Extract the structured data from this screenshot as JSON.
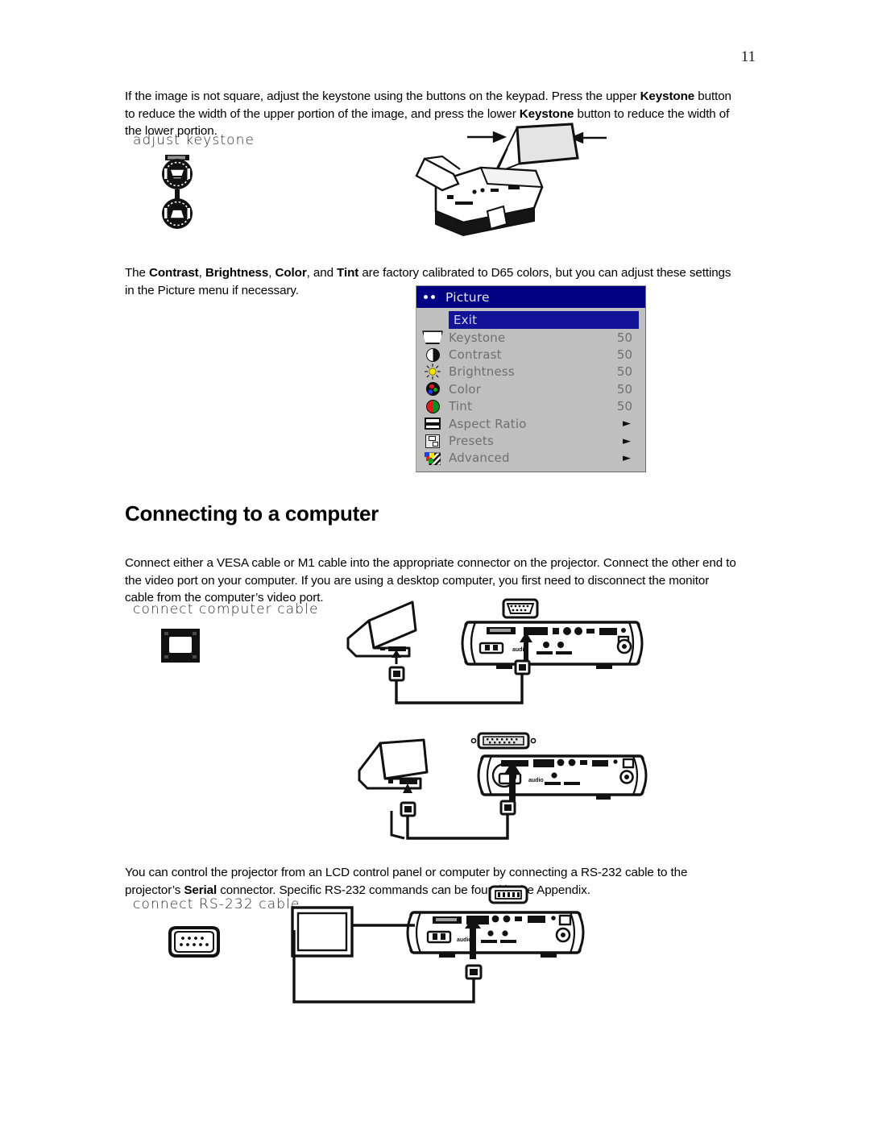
{
  "page": {
    "number": "11"
  },
  "paragraphs": {
    "keystone": {
      "seg1": "If the image is not square, adjust the keystone using the buttons on the keypad. Press the upper ",
      "bold1": "Keystone",
      "seg2": " button to reduce the width of the upper portion of the image, and press the lower ",
      "bold2": "Keystone",
      "seg3": " button to reduce the width of the lower portion."
    },
    "picture": {
      "seg1": "The ",
      "bold1": "Contrast",
      "seg2": ", ",
      "bold2": "Brightness",
      "seg3": ", ",
      "bold3": "Color",
      "seg4": ", and ",
      "bold4": "Tint",
      "seg5": " are factory calibrated to D65 colors, but you can adjust these settings in the Picture menu if necessary."
    },
    "connect": {
      "text": "Connect either a VESA cable or M1 cable into the appropriate connector on the projector. Connect the other end to the video port on your computer. If you are using a desktop computer, you first need to disconnect the monitor cable from the computer’s video port."
    },
    "rs232": {
      "seg1": "You can control the projector from an LCD control panel or computer by connecting a RS-232 cable to the projector’s ",
      "bold1": "Serial",
      "seg2": " connector. Specific RS-232 commands can be found in the Appendix."
    }
  },
  "heading": {
    "connecting_to_a_computer": "Connecting to a computer"
  },
  "captions": {
    "adjust_keystone": "adjust keystone",
    "connect_computer_cable": "connect computer cable",
    "connect_rs232_cable": "connect RS-232 cable"
  },
  "osd_menu": {
    "title": "Picture",
    "colors": {
      "title_bar": "#010183",
      "highlight": "#131397",
      "background": "#bfbfbf",
      "label_text": "#6f6f6f"
    },
    "rows": [
      {
        "label": "Exit",
        "value": "",
        "icon": "none",
        "selected": true
      },
      {
        "label": "Keystone",
        "value": "50",
        "icon": "keystone-icon",
        "selected": false
      },
      {
        "label": "Contrast",
        "value": "50",
        "icon": "contrast-icon",
        "selected": false
      },
      {
        "label": "Brightness",
        "value": "50",
        "icon": "brightness-icon",
        "selected": false
      },
      {
        "label": "Color",
        "value": "50",
        "icon": "color-icon",
        "selected": false
      },
      {
        "label": "Tint",
        "value": "50",
        "icon": "tint-icon",
        "selected": false
      },
      {
        "label": "Aspect Ratio",
        "value": "►",
        "icon": "aspect-ratio-icon",
        "selected": false
      },
      {
        "label": "Presets",
        "value": "►",
        "icon": "presets-icon",
        "selected": false
      },
      {
        "label": "Advanced",
        "value": "►",
        "icon": "advanced-icon",
        "selected": false
      }
    ]
  }
}
